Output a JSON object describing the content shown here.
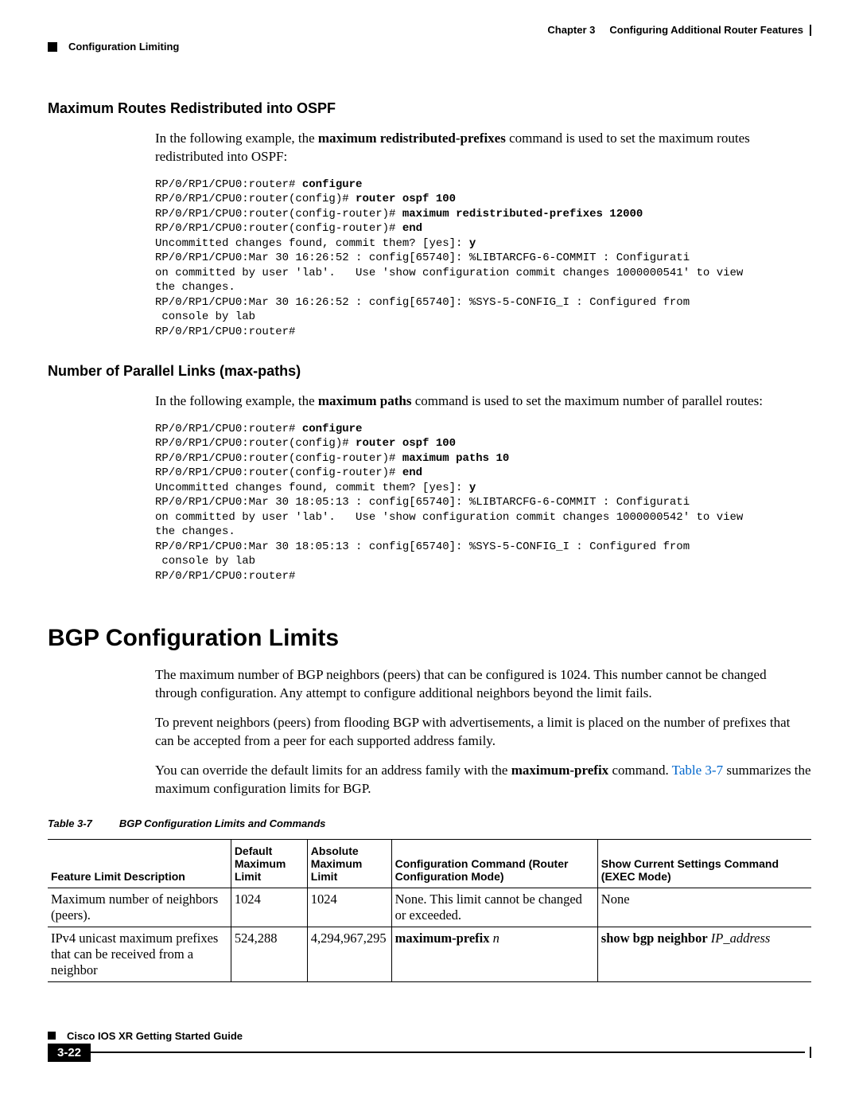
{
  "header": {
    "chapter_label": "Chapter 3",
    "chapter_title": "Configuring Additional Router Features",
    "section": "Configuration Limiting"
  },
  "section_ospf": {
    "heading": "Maximum Routes Redistributed into OSPF",
    "intro_pre": "In the following example, the ",
    "intro_cmd": "maximum redistributed-prefixes",
    "intro_post": " command is used to set the maximum routes redistributed into OSPF:",
    "code_lines": [
      {
        "pre": "RP/0/RP1/CPU0:router# ",
        "bold": "configure",
        "post": ""
      },
      {
        "pre": "RP/0/RP1/CPU0:router(config)# ",
        "bold": "router ospf 100",
        "post": ""
      },
      {
        "pre": "RP/0/RP1/CPU0:router(config-router)# ",
        "bold": "maximum redistributed-prefixes 12000",
        "post": ""
      },
      {
        "pre": "RP/0/RP1/CPU0:router(config-router)# ",
        "bold": "end",
        "post": ""
      },
      {
        "pre": "Uncommitted changes found, commit them? [yes]: ",
        "bold": "y",
        "post": ""
      },
      {
        "pre": "RP/0/RP1/CPU0:Mar 30 16:26:52 : config[65740]: %LIBTARCFG-6-COMMIT : Configurati",
        "bold": "",
        "post": ""
      },
      {
        "pre": "on committed by user 'lab'.   Use 'show configuration commit changes 1000000541' to view",
        "bold": "",
        "post": ""
      },
      {
        "pre": "the changes.",
        "bold": "",
        "post": ""
      },
      {
        "pre": "RP/0/RP1/CPU0:Mar 30 16:26:52 : config[65740]: %SYS-5-CONFIG_I : Configured from",
        "bold": "",
        "post": ""
      },
      {
        "pre": " console by lab",
        "bold": "",
        "post": ""
      },
      {
        "pre": "RP/0/RP1/CPU0:router#",
        "bold": "",
        "post": ""
      }
    ]
  },
  "section_maxpaths": {
    "heading": "Number of Parallel Links (max-paths)",
    "intro_pre": "In the following example, the ",
    "intro_cmd": "maximum paths",
    "intro_post": " command is used to set the maximum number of parallel routes:",
    "code_lines": [
      {
        "pre": "RP/0/RP1/CPU0:router# ",
        "bold": "configure",
        "post": ""
      },
      {
        "pre": "RP/0/RP1/CPU0:router(config)# ",
        "bold": "router ospf 100",
        "post": ""
      },
      {
        "pre": "RP/0/RP1/CPU0:router(config-router)# ",
        "bold": "maximum paths 10",
        "post": ""
      },
      {
        "pre": "RP/0/RP1/CPU0:router(config-router)# ",
        "bold": "end",
        "post": ""
      },
      {
        "pre": "Uncommitted changes found, commit them? [yes]: ",
        "bold": "y",
        "post": ""
      },
      {
        "pre": "RP/0/RP1/CPU0:Mar 30 18:05:13 : config[65740]: %LIBTARCFG-6-COMMIT : Configurati",
        "bold": "",
        "post": ""
      },
      {
        "pre": "on committed by user 'lab'.   Use 'show configuration commit changes 1000000542' to view",
        "bold": "",
        "post": ""
      },
      {
        "pre": "the changes.",
        "bold": "",
        "post": ""
      },
      {
        "pre": "RP/0/RP1/CPU0:Mar 30 18:05:13 : config[65740]: %SYS-5-CONFIG_I : Configured from",
        "bold": "",
        "post": ""
      },
      {
        "pre": " console by lab",
        "bold": "",
        "post": ""
      },
      {
        "pre": "RP/0/RP1/CPU0:router#",
        "bold": "",
        "post": ""
      }
    ]
  },
  "section_bgp": {
    "heading": "BGP Configuration Limits",
    "p1": "The maximum number of BGP neighbors (peers) that can be configured is 1024. This number cannot be changed through configuration. Any attempt to configure additional neighbors beyond the limit fails.",
    "p2": "To prevent neighbors (peers) from flooding BGP with advertisements, a limit is placed on the number of prefixes that can be accepted from a peer for each supported address family.",
    "p3_pre": "You can override the default limits for an address family with the ",
    "p3_cmd": "maximum-prefix",
    "p3_mid": " command. ",
    "p3_link": "Table 3-7",
    "p3_post": " summarizes the maximum configuration limits for BGP.",
    "table": {
      "caption_label": "Table 3-7",
      "caption_title": "BGP Configuration Limits and Commands",
      "headers": [
        "Feature Limit Description",
        "Default Maximum Limit",
        "Absolute Maximum Limit",
        "Configuration Command (Router Configuration Mode)",
        "Show Current Settings Command (EXEC Mode)"
      ],
      "rows": [
        {
          "desc": "Maximum number of neighbors (peers).",
          "default": "1024",
          "absolute": "1024",
          "config": "None. This limit cannot be changed or exceeded.",
          "show": "None"
        },
        {
          "desc": "IPv4 unicast maximum prefixes that can be received from a neighbor",
          "default": "524,288",
          "absolute": "4,294,967,295",
          "config_bold": "maximum-prefix",
          "config_italic": "n",
          "show_bold": "show bgp neighbor",
          "show_italic": "IP_address"
        }
      ]
    }
  },
  "footer": {
    "guide": "Cisco IOS XR Getting Started Guide",
    "page": "3-22"
  }
}
